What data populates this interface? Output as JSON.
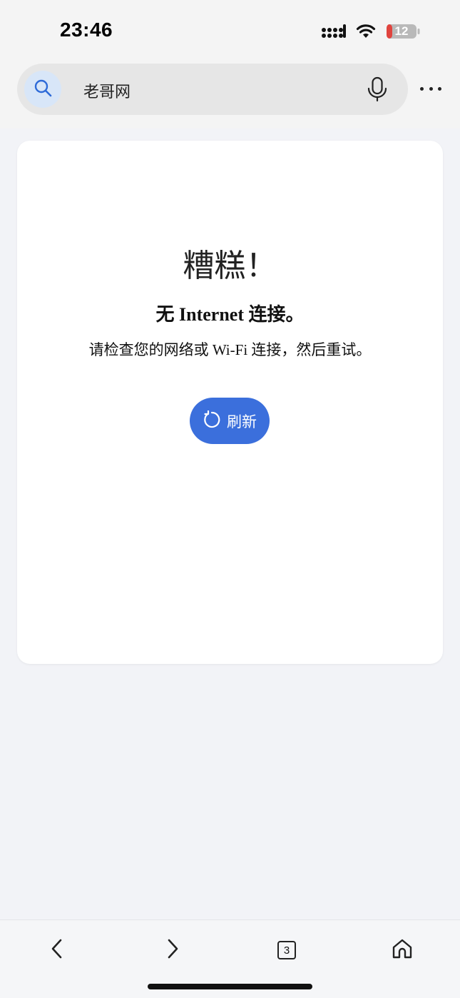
{
  "status_bar": {
    "time": "23:46",
    "battery_level": "12",
    "battery_color": "#e0443e"
  },
  "search": {
    "query": "老哥网",
    "accent_color": "#2f6bd8"
  },
  "error_page": {
    "title": "糟糕！",
    "heading": "无 Internet 连接。",
    "message": "请检查您的网络或 Wi-Fi 连接，然后重试。",
    "refresh_label": "刷新",
    "button_color": "#3b6fdc"
  },
  "toolbar": {
    "tab_count": "3",
    "icons": [
      "back-icon",
      "forward-icon",
      "tabs-icon",
      "home-icon"
    ]
  }
}
